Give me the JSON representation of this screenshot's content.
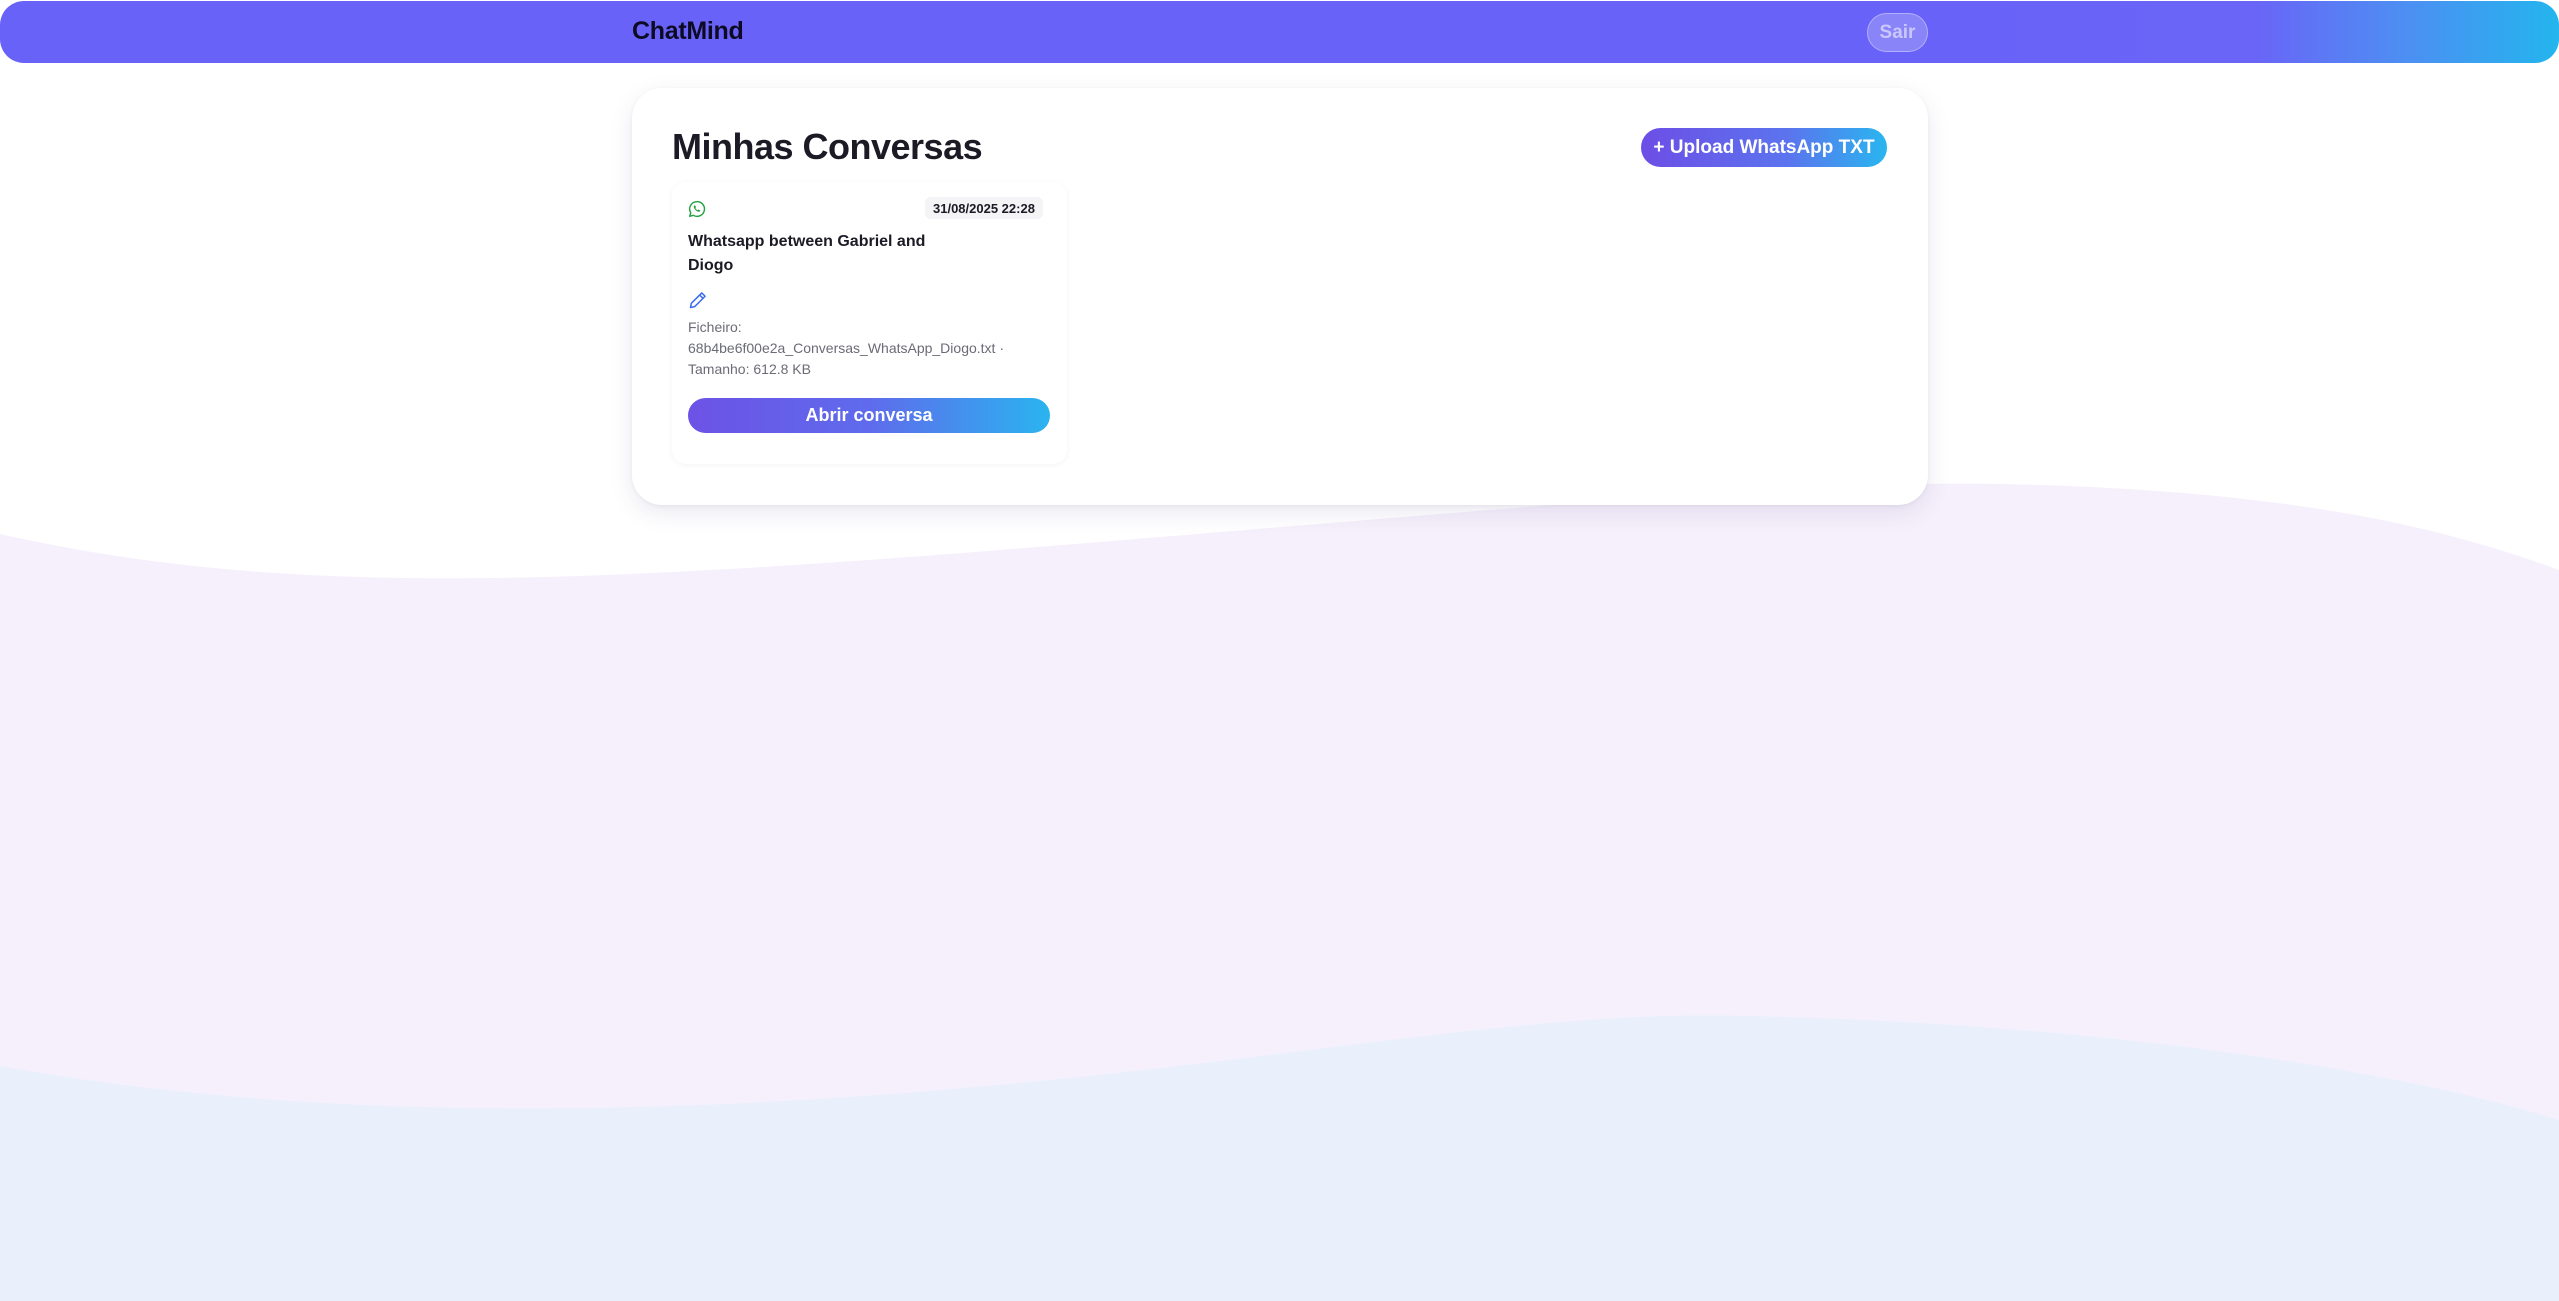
{
  "header": {
    "brand": "ChatMind",
    "logout_label": "Sair"
  },
  "main": {
    "title": "Minhas Conversas",
    "upload_label": "+ Upload WhatsApp TXT"
  },
  "conversations": [
    {
      "icon": "whatsapp-icon",
      "date": "31/08/2025 22:28",
      "title": "Whatsapp between Gabriel and Diogo",
      "edit_icon": "pencil-icon",
      "file_label": "Ficheiro:",
      "file_name": "68b4be6f00e2a_Conversas_WhatsApp_Diogo.txt ·",
      "size_label": "Tamanho: 612.8 KB",
      "open_label": "Abrir conversa"
    }
  ],
  "colors": {
    "header": "#6962f8",
    "accent_start": "#6d4ee6",
    "accent_end": "#29b6ef",
    "whatsapp": "#25a244",
    "edit": "#3b6cf2",
    "wave_1": "#f6f0fc",
    "wave_2": "#e9f0fc"
  }
}
